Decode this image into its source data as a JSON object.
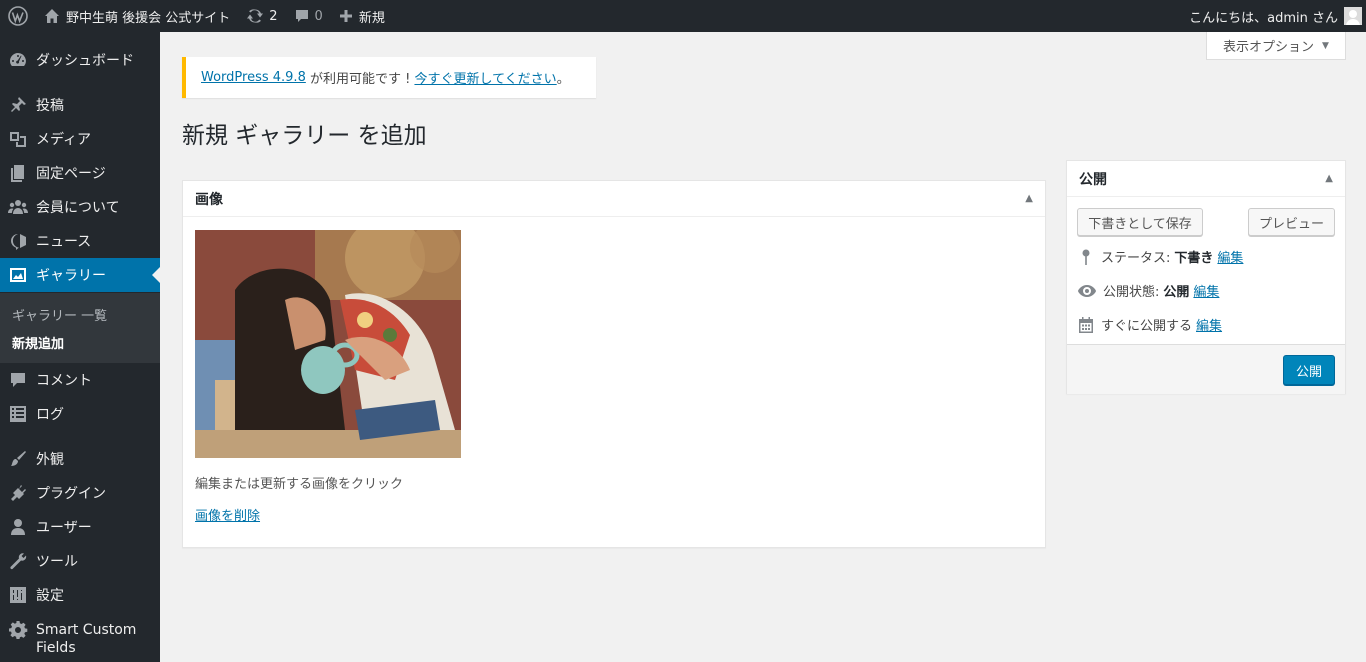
{
  "adminbar": {
    "site_title": "野中生萌 後援会 公式サイト",
    "updates_count": "2",
    "comments_count": "0",
    "new_label": "新規",
    "greeting": "こんにちは、admin さん"
  },
  "sidebar": {
    "items": [
      {
        "label": "ダッシュボード",
        "icon": "dashboard-icon"
      },
      {
        "label": "投稿",
        "icon": "pin-icon"
      },
      {
        "label": "メディア",
        "icon": "media-icon"
      },
      {
        "label": "固定ページ",
        "icon": "page-icon"
      },
      {
        "label": "会員について",
        "icon": "groups-icon"
      },
      {
        "label": "ニュース",
        "icon": "megaphone-icon"
      },
      {
        "label": "ギャラリー",
        "icon": "image-icon"
      },
      {
        "label": "コメント",
        "icon": "comment-icon"
      },
      {
        "label": "ログ",
        "icon": "list-icon"
      },
      {
        "label": "外観",
        "icon": "brush-icon"
      },
      {
        "label": "プラグイン",
        "icon": "plugin-icon"
      },
      {
        "label": "ユーザー",
        "icon": "user-icon"
      },
      {
        "label": "ツール",
        "icon": "wrench-icon"
      },
      {
        "label": "設定",
        "icon": "settings-icon"
      },
      {
        "label": "Smart Custom Fields",
        "icon": "gear-icon"
      }
    ],
    "submenu": [
      "ギャラリー 一覧",
      "新規追加"
    ]
  },
  "screen_options": "表示オプション",
  "notice": {
    "link1": "WordPress 4.9.8",
    "text": " が利用可能です ! ",
    "link2": "今すぐ更新してください",
    "end": "。"
  },
  "page_title": "新規 ギャラリー を追加",
  "image_box": {
    "title": "画像",
    "help": "編集または更新する画像をクリック",
    "remove": "画像を削除"
  },
  "publish_box": {
    "title": "公開",
    "save_draft": "下書きとして保存",
    "preview": "プレビュー",
    "status_label": "ステータス:",
    "status_value": "下書き",
    "visibility_label": "公開状態:",
    "visibility_value": "公開",
    "schedule_label": "すぐに公開する",
    "edit": "編集",
    "publish_button": "公開"
  },
  "colors": {
    "accent": "#0073aa",
    "notice": "#ffb900",
    "primary_button": "#0085ba"
  }
}
